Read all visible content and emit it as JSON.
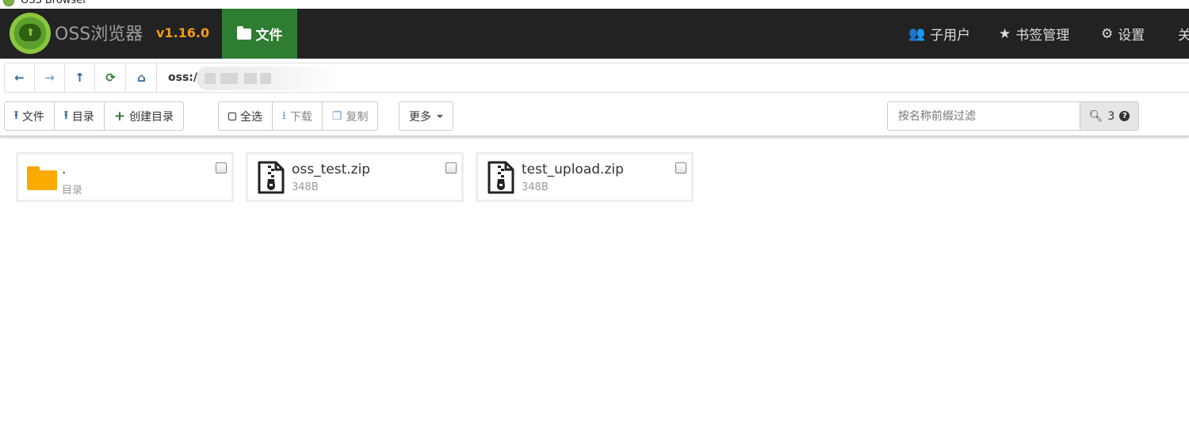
{
  "window": {
    "title": "OSS Browser"
  },
  "navbar": {
    "brand": "OSS浏览器",
    "version": "v1.16.0",
    "active_tab": "文件",
    "right_items": [
      {
        "label": "子用户",
        "icon": "users-icon"
      },
      {
        "label": "书签管理",
        "icon": "star-icon"
      },
      {
        "label": "设置",
        "icon": "gear-icon"
      },
      {
        "label": "关",
        "icon": ""
      }
    ]
  },
  "address": {
    "prefix": "oss:/"
  },
  "toolbar": {
    "upload_file": "文件",
    "upload_dir": "目录",
    "create_dir": "创建目录",
    "select_all": "全选",
    "download": "下载",
    "copy": "复制",
    "more": "更多",
    "filter_placeholder": "按名称前缀过滤",
    "search_count": "3"
  },
  "files": [
    {
      "name": ".",
      "meta": "目录",
      "type": "folder"
    },
    {
      "name": "oss_test.zip",
      "meta": "348B",
      "type": "zip"
    },
    {
      "name": "test_upload.zip",
      "meta": "348B",
      "type": "zip"
    }
  ],
  "colors": {
    "navbar_bg": "#222222",
    "active_tab": "#2e7d32",
    "version": "#f39c12",
    "folder": "#f9ab00"
  }
}
